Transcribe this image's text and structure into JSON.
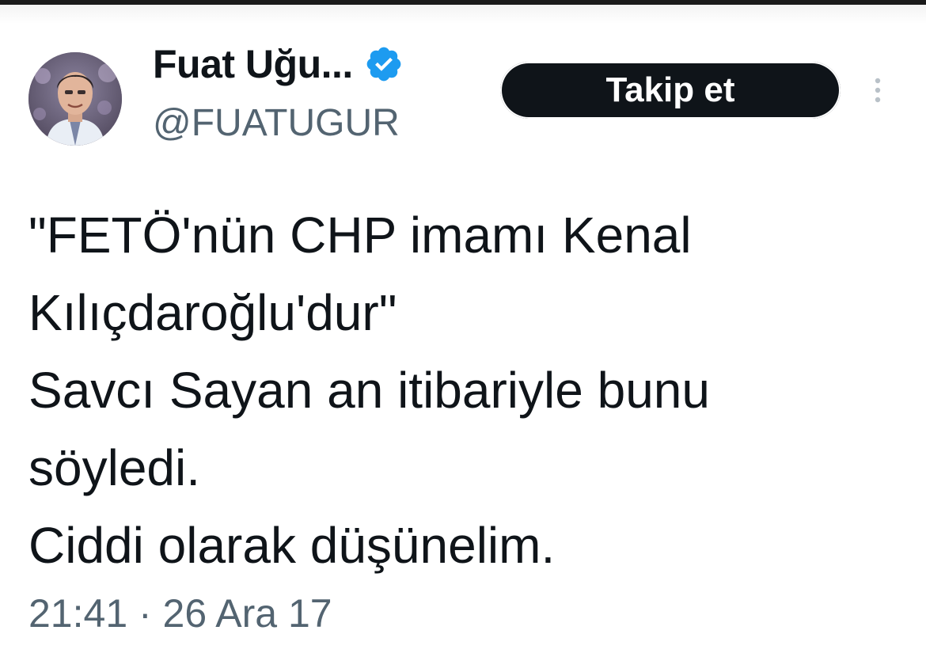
{
  "author": {
    "display_name": "Fuat Uğu...",
    "handle": "@FUATUGUR",
    "verified": true,
    "verified_color": "#1d9bf0"
  },
  "follow_button": {
    "label": "Takip et"
  },
  "more_icon": "more-vertical-icon",
  "tweet": {
    "lines": [
      "\"FETÖ'nün CHP imamı Kenal",
      "Kılıçdaroğlu'dur\"",
      "Savcı Sayan an itibariyle bunu",
      "söyledi.",
      "Ciddi olarak düşünelim."
    ]
  },
  "meta": {
    "timestamp": "21:41 · 26 Ara 17"
  },
  "colors": {
    "text": "#0f1419",
    "secondary_text": "#536471",
    "button_bg": "#0f1419",
    "button_text": "#ffffff"
  }
}
